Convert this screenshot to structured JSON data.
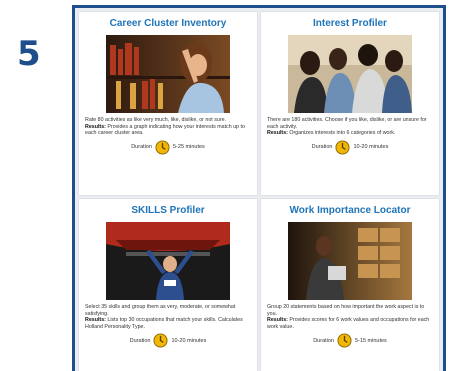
{
  "step_number": "5",
  "cards": [
    {
      "title": "Career Cluster Inventory",
      "description": "Rate 80 activities as like very much, like, dislike, or not sure.",
      "results_label": "Results:",
      "results_text": "Provides a graph indicating how your interests match up to each career cluster area.",
      "duration_label": "Duration",
      "duration_value": "5-25 minutes"
    },
    {
      "title": "Interest Profiler",
      "description": "There are 180 activities. Choose if you like, dislike, or are unsure for each activity.",
      "results_label": "Results:",
      "results_text": "Organizes interests into 6 categories of work.",
      "duration_label": "Duration",
      "duration_value": "10-20 minutes"
    },
    {
      "title": "SKILLS Profiler",
      "description": "Select 35 skills and group them as very, moderate, or somewhat satisfying.",
      "results_label": "Results:",
      "results_text": "Lists top 30 occupations that match your skills. Calculates Holland Personality Type.",
      "duration_label": "Duration",
      "duration_value": "10-20 minutes"
    },
    {
      "title": "Work Importance Locator",
      "description": "Group 20 statements based on how important the work aspect is to you.",
      "results_label": "Results:",
      "results_text": "Provides scores for 6 work values and occupations for each work value.",
      "duration_label": "Duration",
      "duration_value": "5-15 minutes"
    }
  ],
  "colors": {
    "frame_border": "#1f4e8c",
    "title_blue": "#1e74b8",
    "clock_yellow": "#f2b705"
  }
}
